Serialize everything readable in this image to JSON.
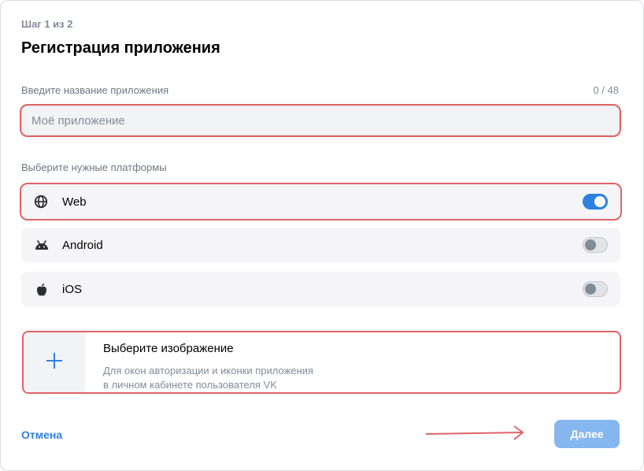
{
  "header": {
    "step": "Шаг 1 из 2",
    "title": "Регистрация приложения"
  },
  "name_field": {
    "label": "Введите название приложения",
    "counter": "0 / 48",
    "placeholder": "Моё приложение",
    "value": ""
  },
  "platforms": {
    "label": "Выберите нужные платформы",
    "items": [
      {
        "label": "Web",
        "icon": "globe-icon",
        "enabled": true
      },
      {
        "label": "Android",
        "icon": "android-icon",
        "enabled": false
      },
      {
        "label": "iOS",
        "icon": "apple-icon",
        "enabled": false
      }
    ]
  },
  "image_picker": {
    "title": "Выберите изображение",
    "description_line1": "Для окон авторизации и иконки приложения",
    "description_line2": "в личном кабинете пользователя VK",
    "icon": "plus-icon"
  },
  "footer": {
    "cancel_label": "Отмена",
    "next_label": "Далее"
  },
  "colors": {
    "accent": "#2d81e0",
    "highlight": "#e06367",
    "disabled_button": "#86b6ee"
  }
}
